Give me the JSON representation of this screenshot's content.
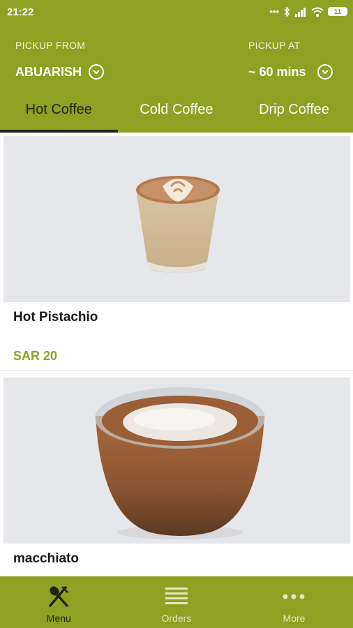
{
  "status": {
    "time": "21:22",
    "battery": "11"
  },
  "pickup": {
    "from_label": "PICKUP FROM",
    "from_value": "ABUARISH",
    "at_label": "PICKUP AT",
    "at_value": "~ 60 mins"
  },
  "tabs": [
    {
      "label": "Hot Coffee",
      "active": true
    },
    {
      "label": "Cold Coffee",
      "active": false
    },
    {
      "label": "Drip Coffee",
      "active": false
    }
  ],
  "products": [
    {
      "name": "Hot Pistachio",
      "price": "SAR 20"
    },
    {
      "name": "macchiato",
      "price": ""
    }
  ],
  "nav": [
    {
      "label": "Menu",
      "icon": "spoon-fork-icon",
      "active": true
    },
    {
      "label": "Orders",
      "icon": "list-icon",
      "active": false
    },
    {
      "label": "More",
      "icon": "more-dots-icon",
      "active": false
    }
  ],
  "colors": {
    "brand": "#8ea123",
    "active_text": "#1e2313",
    "inactive_nav": "#e3e8c4"
  }
}
